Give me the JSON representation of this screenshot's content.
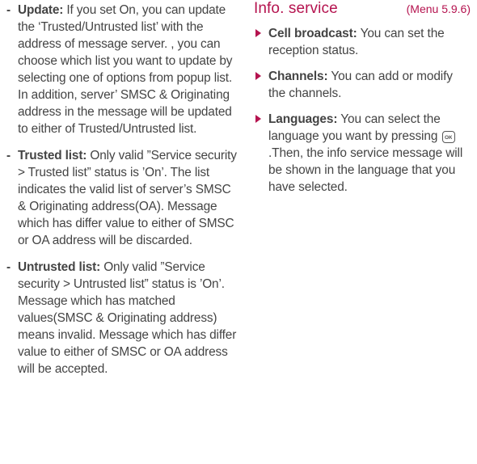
{
  "left_column": {
    "items": [
      {
        "dash": "-",
        "term": "Update:",
        "text": " If you set On, you can update the ‘Trusted/Untrusted list’ with the address of message server. , you can choose which list you want to update by selecting one of options from popup list. In addition, server’ SMSC & Originating address in the message will be updated to either of Trusted/Untrusted list."
      },
      {
        "dash": "-",
        "term": "Trusted list:",
        "text": " Only valid ”Service security > Trusted list” status is ’On’. The list indicates the valid list of server’s SMSC & Originating address(OA). Message which has differ value to either of SMSC or OA address will be discarded."
      },
      {
        "dash": "-",
        "term": "Untrusted list:",
        "text": " Only valid ”Service security > Untrusted list” status is ’On’. Message which has matched values(SMSC & Originating address) means invalid. Message which has differ value to either of SMSC or OA address will be accepted."
      }
    ]
  },
  "right_column": {
    "heading": "Info. service",
    "menu_ref": "(Menu 5.9.6)",
    "bullets": [
      {
        "term": "Cell broadcast:",
        "text": " You can set the reception status."
      },
      {
        "term": "Channels:",
        "text": " You can add or modify the channels."
      },
      {
        "term": "Languages:",
        "text_before": " You can select the language you want by pressing ",
        "icon": "ok-key-icon",
        "text_after": " .Then, the info service message will be shown in the language that you have selected."
      }
    ]
  },
  "colors": {
    "accent": "#b5134f",
    "body_text": "#444444"
  }
}
